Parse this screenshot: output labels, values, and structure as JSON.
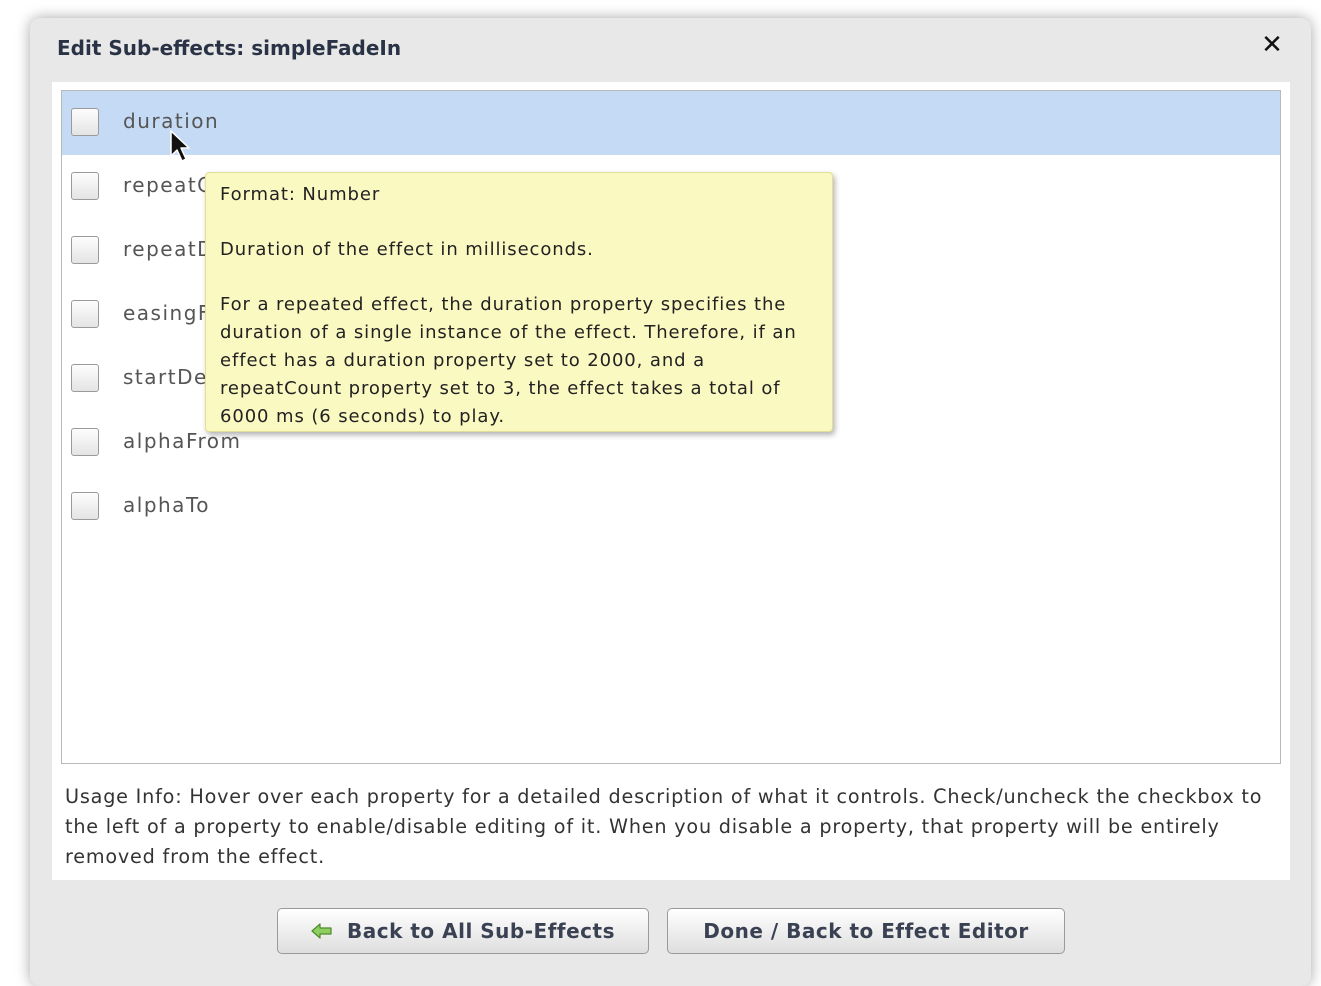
{
  "dialog": {
    "title": "Edit Sub-effects: simpleFadeIn",
    "close_glyph": "✕"
  },
  "properties": [
    {
      "label": "duration",
      "checked": false,
      "selected": true
    },
    {
      "label": "repeatC",
      "checked": false,
      "selected": false
    },
    {
      "label": "repeatD",
      "checked": false,
      "selected": false
    },
    {
      "label": "easingF",
      "checked": false,
      "selected": false
    },
    {
      "label": "startDe",
      "checked": false,
      "selected": false
    },
    {
      "label": "alphaFrom",
      "checked": false,
      "selected": false
    },
    {
      "label": "alphaTo",
      "checked": false,
      "selected": false
    }
  ],
  "tooltip": {
    "format": "Format: Number",
    "summary": "Duration of the effect in milliseconds.",
    "detail": "For a repeated effect, the duration property specifies the duration of a single instance of the effect. Therefore, if an effect has a duration property set to 2000, and a repeatCount property set to 3, the effect takes a total of 6000 ms (6 seconds) to play."
  },
  "usage_info": "Usage Info: Hover over each property for a detailed description of what it controls.  Check/uncheck the checkbox to the left of a property to enable/disable editing of it.  When you disable a property, that property will be entirely removed from the effect.",
  "buttons": {
    "back": "Back to All Sub-Effects",
    "done": "Done / Back to Effect Editor"
  },
  "colors": {
    "selected_row": "#c5daf5",
    "tooltip_bg": "#fbf9c2",
    "arrow_green": "#6cb33f"
  }
}
